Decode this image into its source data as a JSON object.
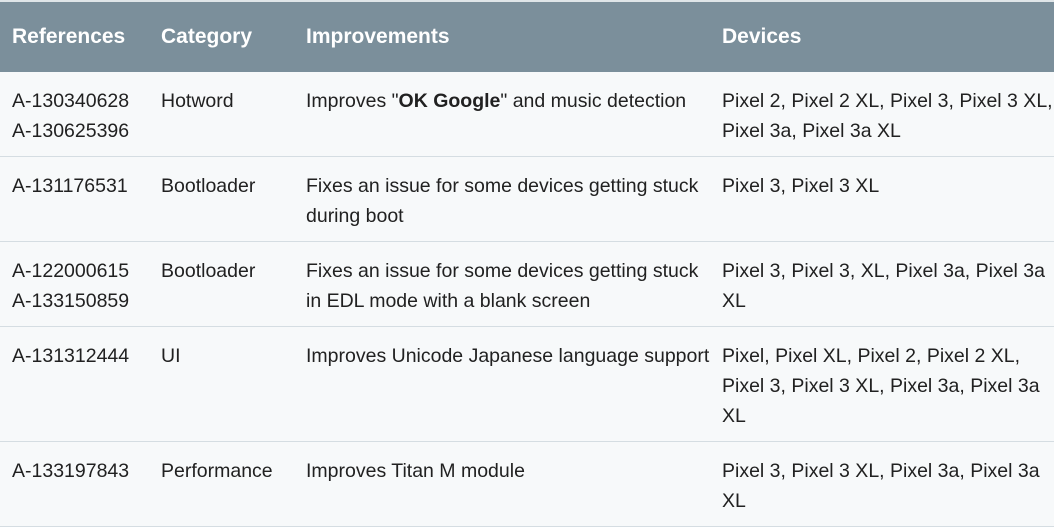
{
  "table": {
    "headers": [
      "References",
      "Category",
      "Improvements",
      "Devices"
    ],
    "rows": [
      {
        "references": [
          "A-130340628",
          "A-130625396"
        ],
        "category": "Hotword",
        "improvement_pre": "Improves \"",
        "improvement_bold": "OK Google",
        "improvement_post": "\" and music detection",
        "devices": "Pixel 2, Pixel 2 XL, Pixel 3, Pixel 3 XL, Pixel 3a, Pixel 3a XL"
      },
      {
        "references": [
          "A-131176531"
        ],
        "category": "Bootloader",
        "improvement": "Fixes an issue for some devices getting stuck during boot",
        "devices": "Pixel 3, Pixel 3 XL"
      },
      {
        "references": [
          "A-122000615",
          "A-133150859"
        ],
        "category": "Bootloader",
        "improvement": "Fixes an issue for some devices getting stuck in EDL mode with a blank screen",
        "devices": "Pixel 3, Pixel 3, XL, Pixel 3a, Pixel 3a XL"
      },
      {
        "references": [
          "A-131312444"
        ],
        "category": "UI",
        "improvement": "Improves Unicode Japanese language support",
        "devices": "Pixel, Pixel XL, Pixel 2, Pixel 2 XL, Pixel 3, Pixel 3 XL, Pixel 3a, Pixel 3a XL"
      },
      {
        "references": [
          "A-133197843"
        ],
        "category": "Performance",
        "improvement": "Improves Titan M module",
        "devices": "Pixel 3, Pixel 3 XL, Pixel 3a, Pixel 3a XL"
      }
    ]
  }
}
